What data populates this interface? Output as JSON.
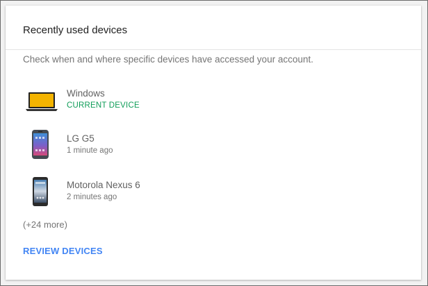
{
  "card": {
    "title": "Recently used devices",
    "subtitle": "Check when and where specific devices have accessed your account."
  },
  "devices": [
    {
      "name": "Windows",
      "meta": "CURRENT DEVICE",
      "icon": "laptop-icon"
    },
    {
      "name": "LG G5",
      "meta": "1 minute ago",
      "icon": "lg-g5-phone-icon"
    },
    {
      "name": "Motorola Nexus 6",
      "meta": "2 minutes ago",
      "icon": "nexus-6-phone-icon"
    }
  ],
  "more": "(+24 more)",
  "review_label": "REVIEW DEVICES",
  "colors": {
    "current_device": "#0f9d58",
    "link": "#4285f4",
    "laptop_screen": "#f4b400"
  }
}
